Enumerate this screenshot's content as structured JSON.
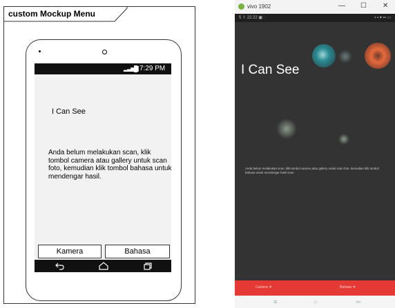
{
  "mockup": {
    "frame_title": "custom Mockup Menu",
    "status_time": "7:29 PM",
    "app_title": "I Can See",
    "message": "Anda belum melakukan scan, klik tombol camera atau gallery untuk scan foto, kemudian klik tombol bahasa untuk mendengar hasil.",
    "buttons": {
      "kamera": "Kamera",
      "bahasa": "Bahasa"
    },
    "icons": [
      "back-icon",
      "home-icon",
      "recents-icon",
      "signal-icon",
      "battery-icon"
    ]
  },
  "emulator": {
    "window_title": "vivo 1902",
    "window_controls": [
      "—",
      "☐",
      "✕"
    ],
    "status_left": "5 ⇧ 22:22 ▣ ·",
    "status_right": "▪ ▪ ▾ ▪▪ ▭",
    "app_title": "I Can See",
    "message": "Anda belum melakukan scan, klik tombol camera atau gallery untuk scan foto, kemudian klik tombol bahasa untuk mendengar hasil scan",
    "bottom_buttons": {
      "camera": "Camera ▼",
      "bahasa": "Bahasa ▼"
    },
    "nav_icons": {
      "recents": "≡",
      "home": "○",
      "back": "⇦"
    },
    "colors": {
      "accent": "#e53935",
      "fab_teal": "#2a8b93",
      "fab_orange": "#e66a3c",
      "background": "#333333"
    }
  }
}
